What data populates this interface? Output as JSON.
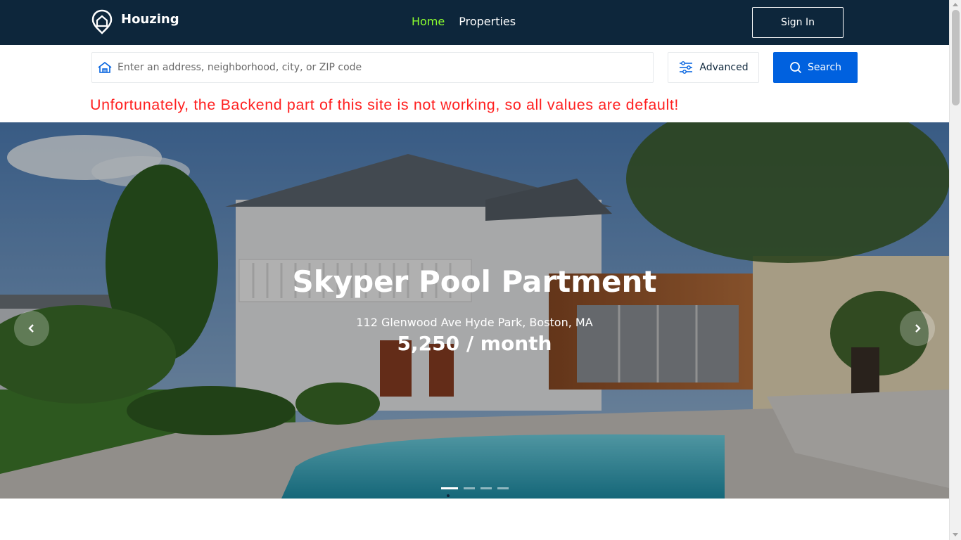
{
  "header": {
    "brand": "Houzing",
    "nav": [
      {
        "label": "Home",
        "active": true
      },
      {
        "label": "Properties",
        "active": false
      }
    ],
    "signin_label": "Sign In"
  },
  "search": {
    "placeholder": "Enter an address, neighborhood, city, or ZIP code",
    "value": "",
    "advanced_label": "Advanced",
    "search_label": "Search"
  },
  "warning": "Unfortunately, the Backend part of this site is not working, so all values are default!",
  "hero": {
    "title": "Skyper Pool Partment",
    "address": "112 Glenwood Ave Hyde Park, Boston, MA",
    "price": "5,250 / month",
    "slide_count": 4,
    "active_slide": 1
  },
  "colors": {
    "navbar": "#0d263b",
    "nav_active": "#8cff2f",
    "primary": "#0061df",
    "warning": "#ff1f1f"
  },
  "icons": [
    "logo-house-pin-icon",
    "house-icon",
    "sliders-icon",
    "search-icon",
    "chevron-left-icon",
    "chevron-right-icon"
  ]
}
